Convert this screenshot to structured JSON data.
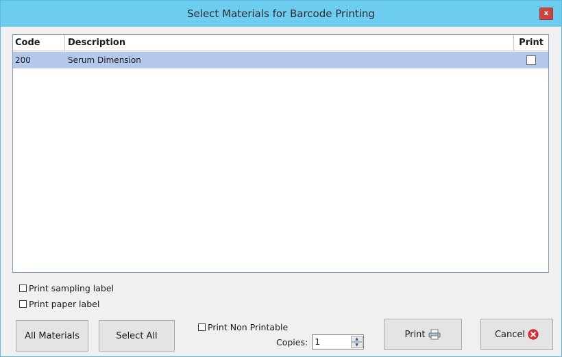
{
  "window": {
    "title": "Select Materials for Barcode Printing",
    "close_label": "x"
  },
  "grid": {
    "columns": [
      "Code",
      "Description",
      "Print"
    ],
    "rows": [
      {
        "code": "200",
        "description": "Serum Dimension",
        "print": false,
        "selected": true
      }
    ]
  },
  "options": {
    "print_sampling_label": "Print sampling label",
    "print_paper_label": "Print paper label",
    "print_non_printable": "Print Non Printable"
  },
  "buttons": {
    "all_materials": "All Materials",
    "select_all": "Select All",
    "print": "Print",
    "cancel": "Cancel"
  },
  "copies": {
    "label": "Copies:",
    "value": "1"
  },
  "colors": {
    "titlebar": "#6ccdf0",
    "selected_row": "#b4c8ec",
    "close_button": "#c9463d",
    "cancel_icon": "#d9343a"
  }
}
